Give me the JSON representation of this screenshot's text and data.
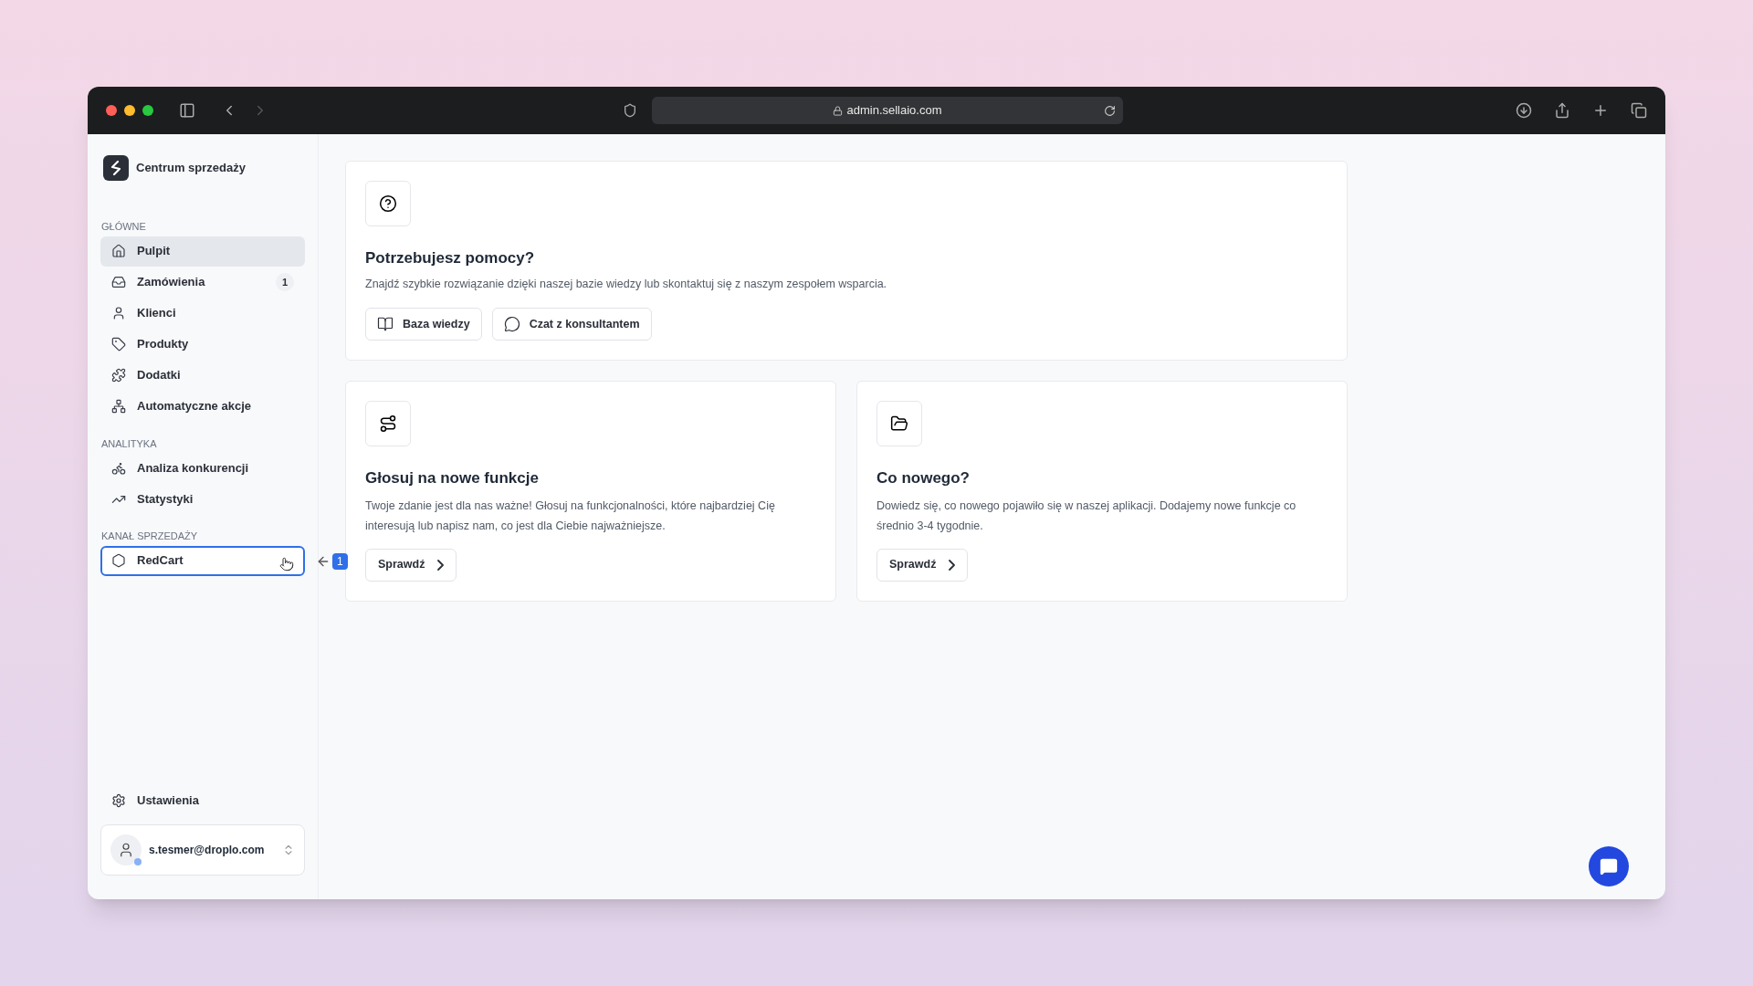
{
  "browser": {
    "url": "admin.sellaio.com"
  },
  "sidebar": {
    "brand": "Centrum sprzedaży",
    "sections": [
      {
        "title": "GŁÓWNE",
        "items": [
          {
            "label": "Pulpit",
            "selected": true,
            "highlighted": false
          },
          {
            "label": "Zamówienia",
            "selected": false,
            "highlighted": false,
            "badge": "1"
          },
          {
            "label": "Klienci",
            "selected": false,
            "highlighted": false
          },
          {
            "label": "Produkty",
            "selected": false,
            "highlighted": false
          },
          {
            "label": "Dodatki",
            "selected": false,
            "highlighted": false
          },
          {
            "label": "Automatyczne akcje",
            "selected": false,
            "highlighted": false
          }
        ]
      },
      {
        "title": "ANALITYKA",
        "items": [
          {
            "label": "Analiza konkurencji",
            "selected": false,
            "highlighted": false
          },
          {
            "label": "Statystyki",
            "selected": false,
            "highlighted": false
          }
        ]
      },
      {
        "title": "KANAŁ SPRZEDAŻY",
        "items": [
          {
            "label": "RedCart",
            "selected": false,
            "highlighted": true
          }
        ]
      }
    ],
    "settings": "Ustawienia",
    "user": {
      "email": "s.tesmer@droplo.com"
    }
  },
  "callout": {
    "label": "1"
  },
  "help_card": {
    "title": "Potrzebujesz pomocy?",
    "text": "Znajdź szybkie rozwiązanie dzięki naszej bazie wiedzy lub skontaktuj się z naszym zespołem wsparcia.",
    "buttons": [
      "Baza wiedzy",
      "Czat z konsultantem"
    ]
  },
  "cards": [
    {
      "title": "Głosuj na nowe funkcje",
      "text": "Twoje zdanie jest dla nas ważne! Głosuj na funkcjonalności, które najbardziej Cię interesują lub napisz nam, co jest dla Ciebie najważniejsze.",
      "button": "Sprawdź"
    },
    {
      "title": "Co nowego?",
      "text": "Dowiedz się, co nowego pojawiło się w naszej aplikacji. Dodajemy nowe funkcje co średnio 3-4 tygodnie.",
      "button": "Sprawdź"
    }
  ]
}
